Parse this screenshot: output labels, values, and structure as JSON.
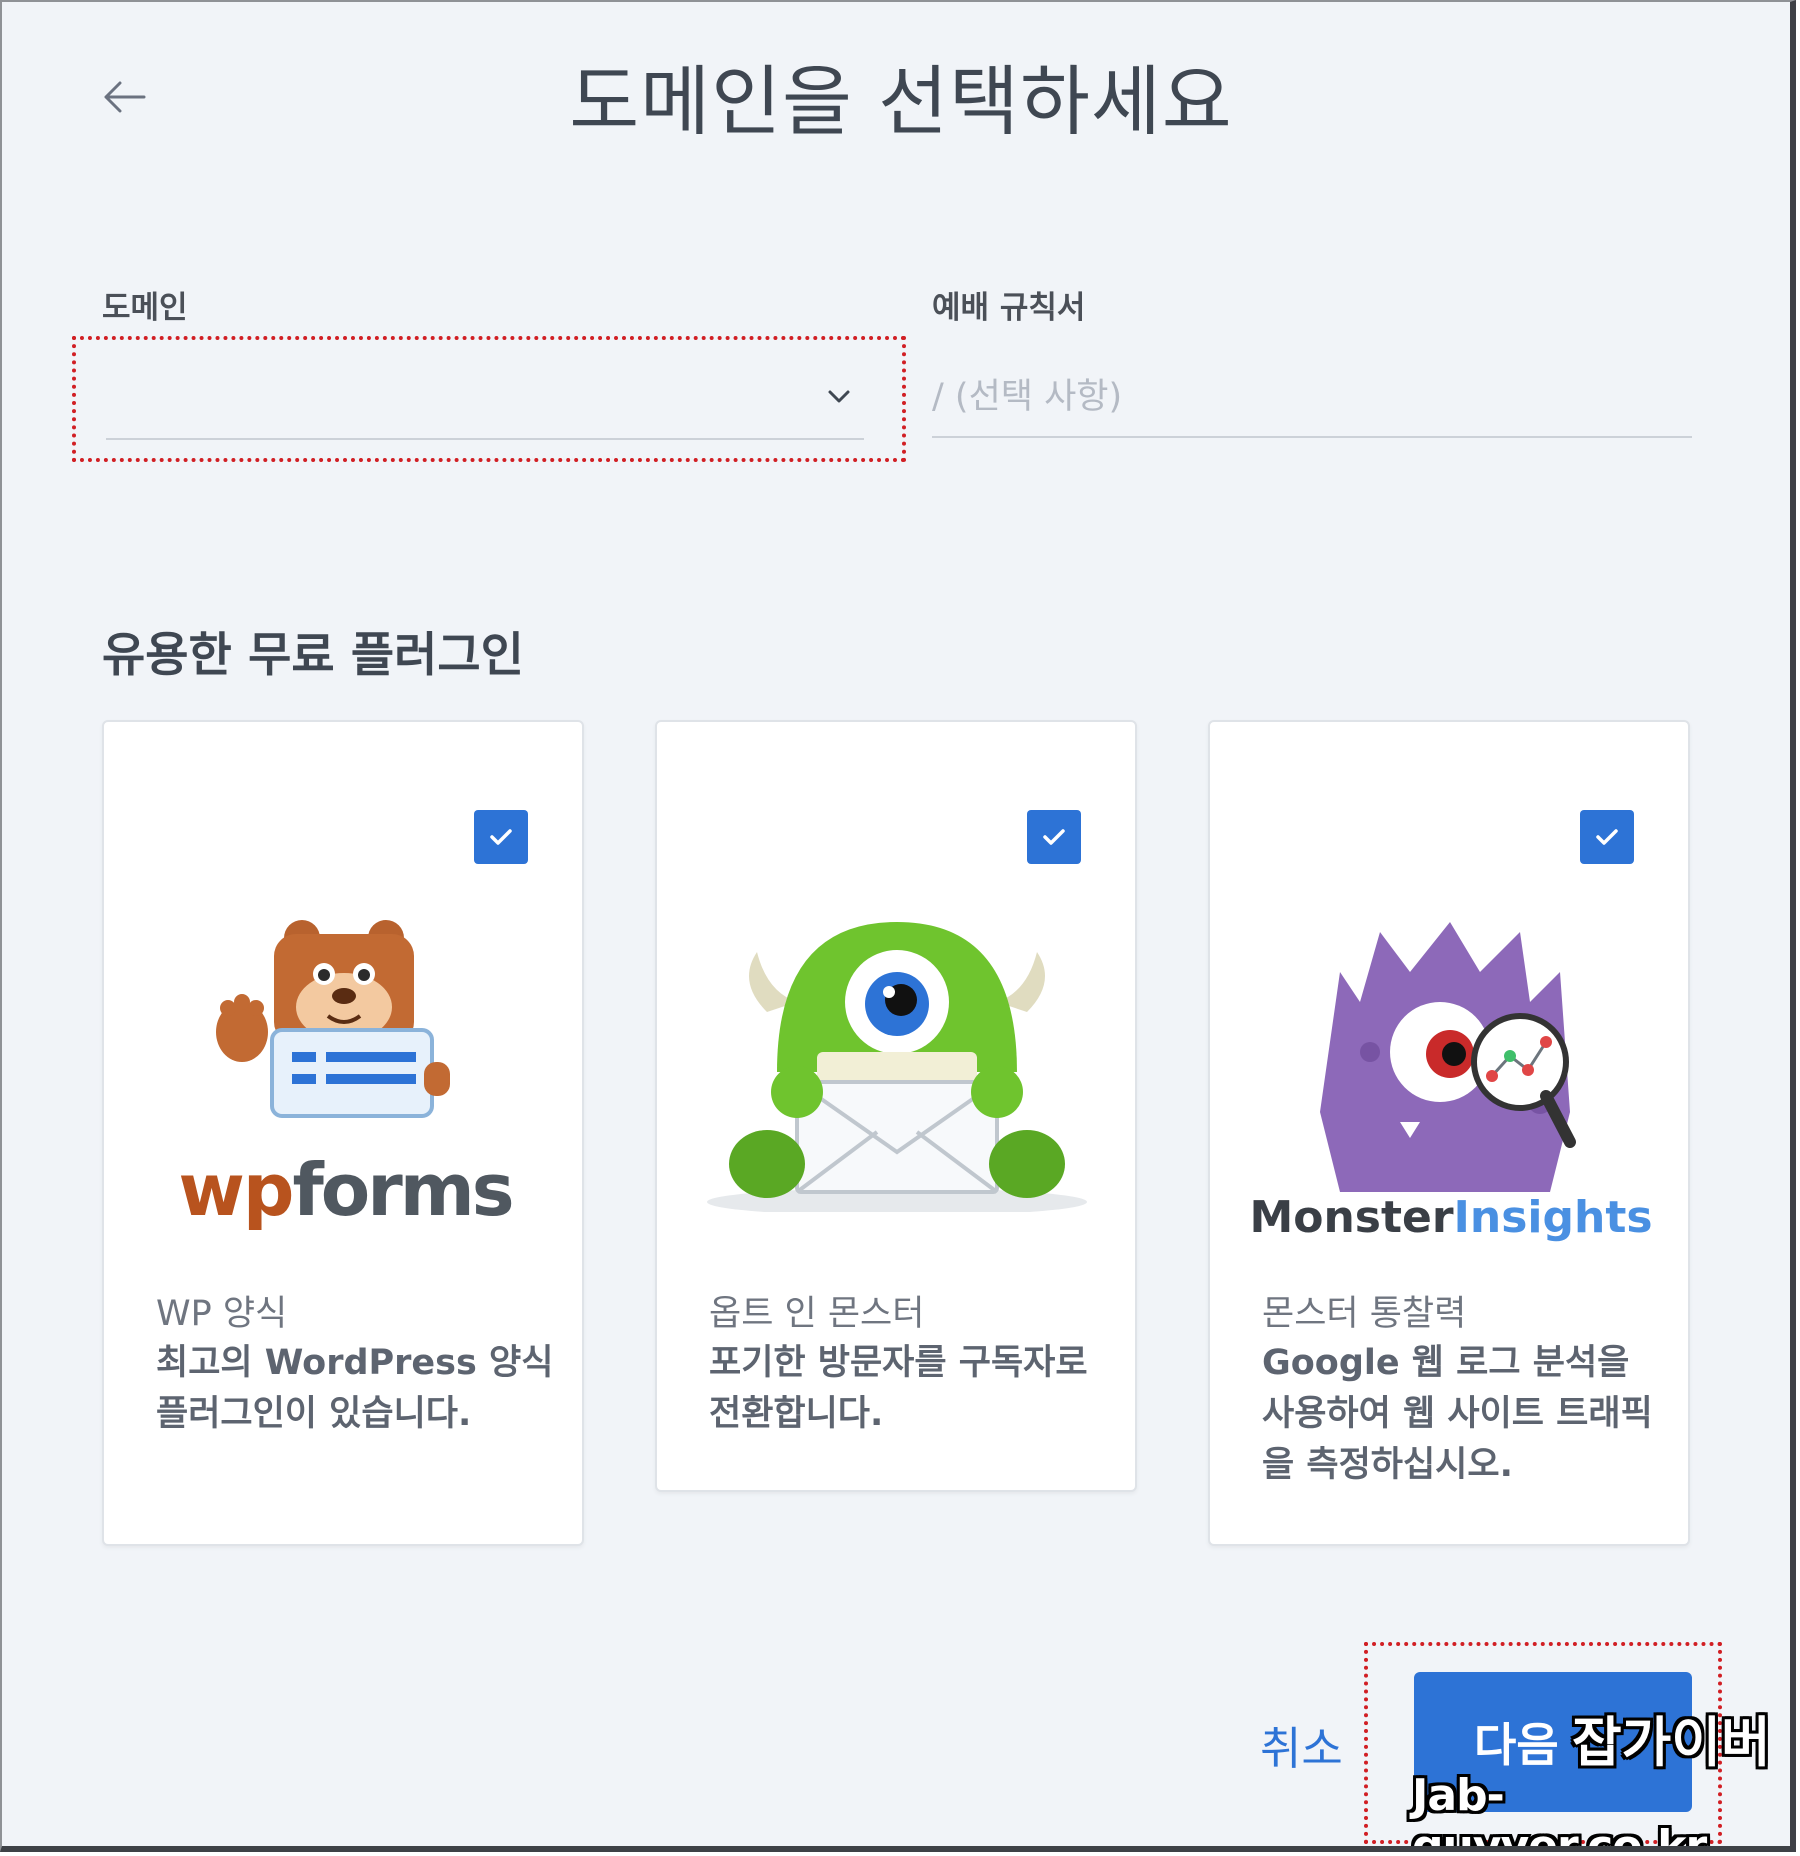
{
  "header": {
    "title": "도메인을 선택하세요"
  },
  "form": {
    "domain_label": "도메인",
    "rules_label": "예배 규칙서",
    "rules_placeholder": "/ (선택 사항)"
  },
  "plugins": {
    "section_title": "유용한 무료 플러그인",
    "accent": "#2d73d6",
    "items": [
      {
        "logo_text_a": "wp",
        "logo_text_b": "forms",
        "name": "WP 양식",
        "description": "최고의 WordPress 양식 플러그인이 있습니다.",
        "checked": true
      },
      {
        "name": "옵트 인 몬스터",
        "description": "포기한 방문자를 구독자로 전환합니다.",
        "checked": true
      },
      {
        "logo_text_a": "Monster",
        "logo_text_b": "Insights",
        "name": "몬스터 통찰력",
        "description": "Google 웹 로그 분석을 사용하여 웹 사이트 트래픽을 측정하십시오.",
        "checked": true
      }
    ]
  },
  "footer": {
    "cancel_label": "취소",
    "next_label": "다음"
  },
  "watermark": {
    "line1": "잡가이버",
    "line2": "Jab-guyver.co.kr"
  }
}
